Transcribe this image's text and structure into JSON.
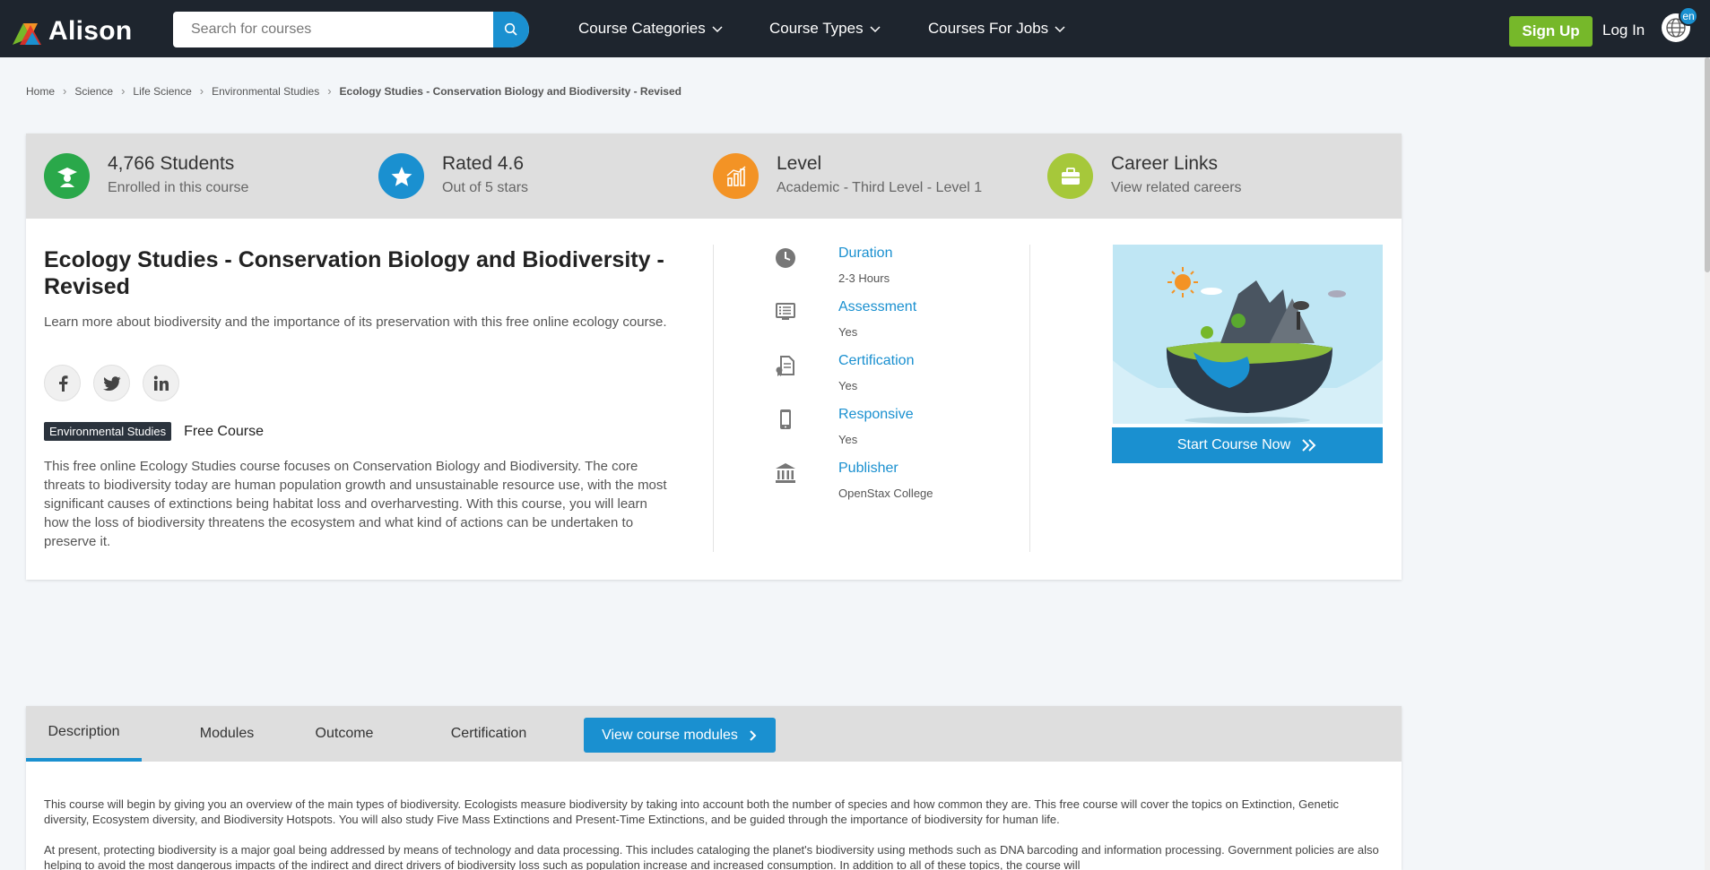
{
  "brand": {
    "name": "Alison"
  },
  "header": {
    "search_placeholder": "Search for courses",
    "nav": [
      "Course Categories",
      "Course Types",
      "Courses For Jobs"
    ],
    "signup_label": "Sign Up",
    "login_label": "Log In",
    "language": "en"
  },
  "breadcrumb": [
    "Home",
    "Science",
    "Life Science",
    "Environmental Studies",
    "Ecology Studies - Conservation Biology and Biodiversity - Revised"
  ],
  "stats": [
    {
      "title": "4,766 Students",
      "sub": "Enrolled in this course",
      "color": "#2aa84a"
    },
    {
      "title": "Rated 4.6",
      "sub": "Out of 5 stars",
      "color": "#1a90d0"
    },
    {
      "title": "Level",
      "sub": "Academic - Third Level - Level 1",
      "color": "#f39325"
    },
    {
      "title": "Career Links",
      "sub": "View related careers",
      "color": "#a6c83a"
    }
  ],
  "course": {
    "title": "Ecology Studies - Conservation Biology and Biodiversity - Revised",
    "summary": "Learn more about biodiversity and the importance of its preservation with this free online ecology course.",
    "tag": "Environmental Studies",
    "price_label": "Free Course",
    "description": "This free online Ecology Studies course focuses on Conservation Biology and Biodiversity. The core threats to biodiversity today are human population growth and unsustainable resource use, with the most significant causes of extinctions being habitat loss and overharvesting. With this course, you will learn how the loss of biodiversity threatens the ecosystem and what kind of actions can be undertaken to preserve it."
  },
  "meta": [
    {
      "label": "Duration",
      "value": "2-3 Hours",
      "icon": "clock-icon"
    },
    {
      "label": "Assessment",
      "value": "Yes",
      "icon": "assessment-icon"
    },
    {
      "label": "Certification",
      "value": "Yes",
      "icon": "certificate-icon"
    },
    {
      "label": "Responsive",
      "value": "Yes",
      "icon": "mobile-icon"
    },
    {
      "label": "Publisher",
      "value": "OpenStax College",
      "icon": "institution-icon"
    }
  ],
  "start_label": "Start Course Now",
  "tabs": [
    "Description",
    "Modules",
    "Outcome",
    "Certification"
  ],
  "modules_button": "View course modules",
  "description_paragraphs": [
    "This course will begin by giving you an overview of the main types of biodiversity. Ecologists measure biodiversity by taking into account both the number of species and how common they are. This free course will cover the topics on Extinction, Genetic diversity, Ecosystem diversity, and Biodiversity Hotspots. You will also study Five Mass Extinctions and Present-Time Extinctions, and be guided through the importance of biodiversity for human life.",
    "At present, protecting biodiversity is a major goal being addressed by means of technology and data processing. This includes cataloging the planet's biodiversity using methods such as DNA barcoding and information processing. Government policies are also helping to avoid the most dangerous impacts of the indirect and direct drivers of biodiversity loss such as population increase and increased consumption. In addition to all of these topics, the course will"
  ]
}
